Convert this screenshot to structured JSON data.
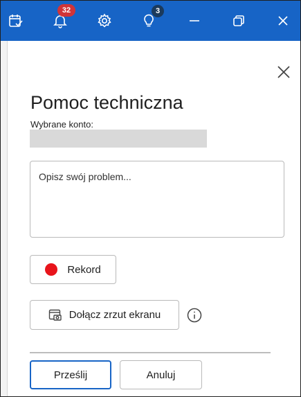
{
  "titlebar": {
    "notifications_count": "32",
    "tips_count": "3",
    "accent": "#1764c6"
  },
  "panel": {
    "title": "Pomoc techniczna",
    "account_label": "Wybrane konto:",
    "account_value": "",
    "description_placeholder": "Opisz swój problem...",
    "record_label": "Rekord",
    "screenshot_label": "Dołącz zrzut ekranu",
    "submit_label": "Prześlij",
    "cancel_label": "Anuluj"
  },
  "icons": {
    "titlebar": [
      "task-check-icon",
      "bell-icon",
      "gear-icon",
      "lightbulb-icon",
      "minimize-icon",
      "restore-icon",
      "close-icon"
    ],
    "panel": [
      "close-icon",
      "record-dot-icon",
      "screenshot-icon",
      "info-icon"
    ]
  }
}
